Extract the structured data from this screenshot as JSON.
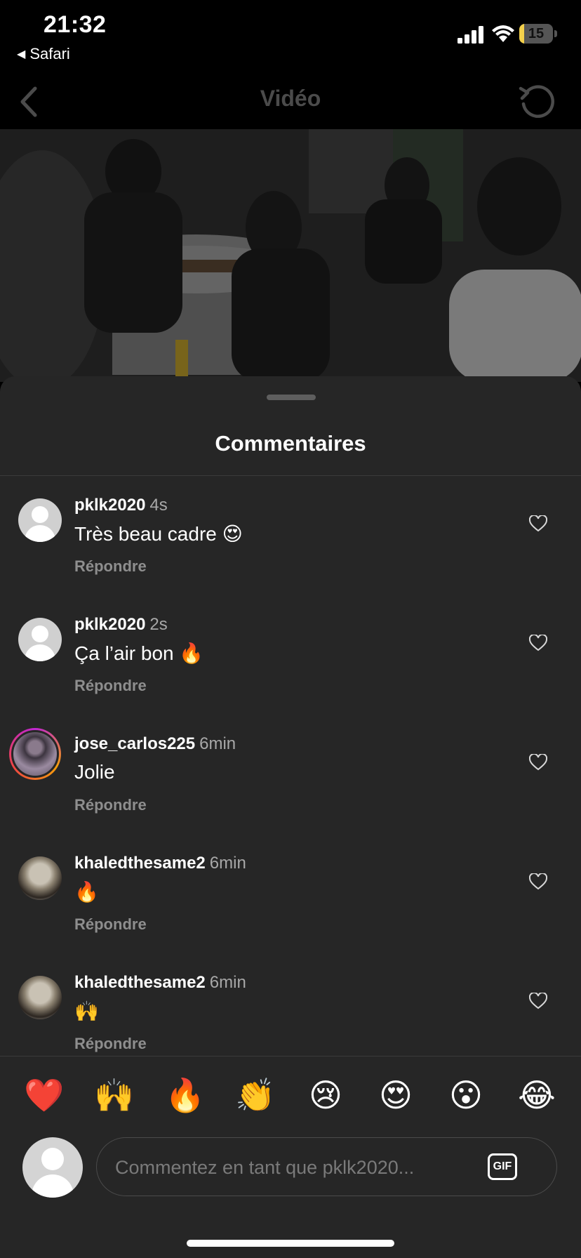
{
  "status_bar": {
    "time": "21:32",
    "back_app": "Safari",
    "battery": "15",
    "battery_level": 0.15
  },
  "nav": {
    "title": "Vidéo",
    "back_icon": "chevron-left-icon",
    "refresh_icon": "refresh-icon"
  },
  "sheet": {
    "title": "Commentaires"
  },
  "comments": [
    {
      "user": "pklk2020",
      "ago": "4s",
      "text": "Très beau cadre 😍",
      "reply": "Répondre",
      "avatar": "default"
    },
    {
      "user": "pklk2020",
      "ago": "2s",
      "text": "Ça l’air bon 🔥",
      "reply": "Répondre",
      "avatar": "default"
    },
    {
      "user": "jose_carlos225",
      "ago": "6min",
      "text": "Jolie",
      "reply": "Répondre",
      "avatar": "story"
    },
    {
      "user": "khaledthesame2",
      "ago": "6min",
      "text": "🔥",
      "reply": "Répondre",
      "avatar": "photo"
    },
    {
      "user": "khaledthesame2",
      "ago": "6min",
      "text": "🙌",
      "reply": "Répondre",
      "avatar": "photo"
    }
  ],
  "reactions": [
    "❤️",
    "🙌",
    "🔥",
    "👏",
    "😢",
    "😍",
    "😮",
    "😂"
  ],
  "composer": {
    "placeholder": "Commentez en tant que pklk2020...",
    "gif_label": "GIF"
  }
}
